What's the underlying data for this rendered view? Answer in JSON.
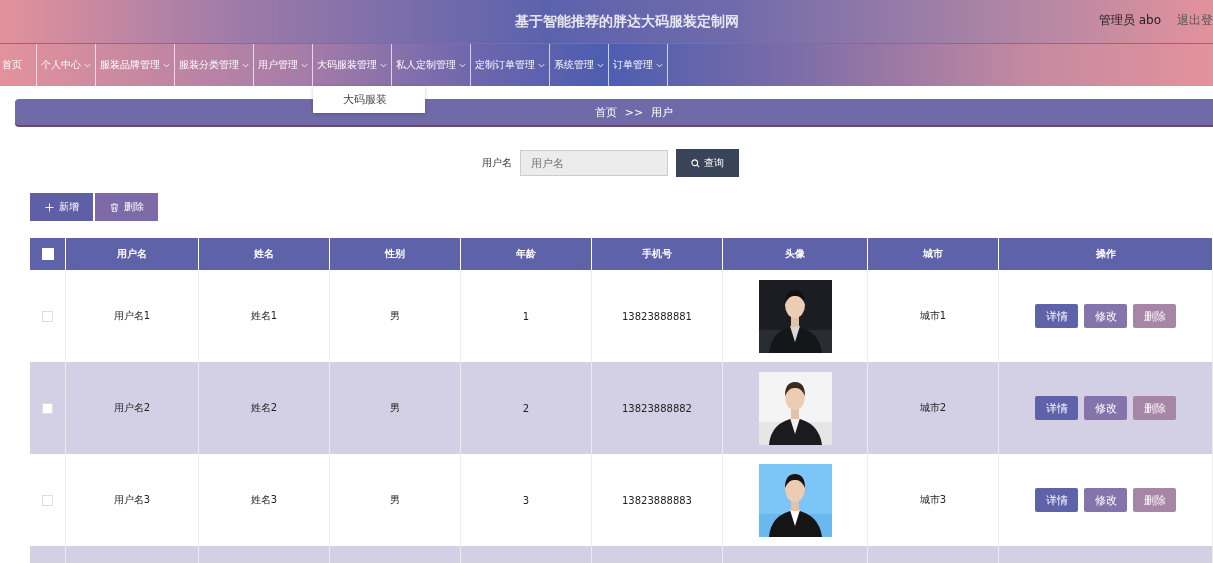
{
  "header": {
    "title": "基于智能推荐的胖达大码服装定制网",
    "user": "管理员 abo",
    "logout": "退出登"
  },
  "nav": [
    {
      "label": "首页",
      "caret": false,
      "expanded": false
    },
    {
      "label": "个人中心",
      "caret": true,
      "expanded": false
    },
    {
      "label": "服装品牌管理",
      "caret": true,
      "expanded": false
    },
    {
      "label": "服装分类管理",
      "caret": true,
      "expanded": false
    },
    {
      "label": "用户管理",
      "caret": true,
      "expanded": false
    },
    {
      "label": "大码服装管理",
      "caret": true,
      "expanded": true,
      "children": [
        "大码服装"
      ]
    },
    {
      "label": "私人定制管理",
      "caret": true,
      "expanded": false
    },
    {
      "label": "定制订单管理",
      "caret": true,
      "expanded": false
    },
    {
      "label": "系统管理",
      "caret": true,
      "expanded": false
    },
    {
      "label": "订单管理",
      "caret": true,
      "expanded": false
    }
  ],
  "breadcrumb": {
    "home": "首页",
    "separator": ">>",
    "current": "用户"
  },
  "search": {
    "label": "用户名",
    "placeholder": "用户名",
    "button": "查询"
  },
  "actions": [
    {
      "kind": "add",
      "label": "新增"
    },
    {
      "kind": "delete",
      "label": "删除"
    }
  ],
  "table": {
    "select_all": {
      "checked": false
    },
    "columns": [
      "用户名",
      "姓名",
      "性别",
      "年龄",
      "手机号",
      "头像",
      "城市",
      "操作"
    ],
    "rows": [
      {
        "checked": false,
        "cells": [
          "用户名1",
          "姓名1",
          "男",
          "1",
          "13823888881"
        ],
        "city": "城市1",
        "buttons": [
          "详情",
          "修改",
          "删除"
        ]
      },
      {
        "checked": false,
        "cells": [
          "用户名2",
          "姓名2",
          "男",
          "2",
          "13823888882"
        ],
        "city": "城市2",
        "buttons": [
          "详情",
          "修改",
          "删除"
        ]
      },
      {
        "checked": false,
        "cells": [
          "用户名3",
          "姓名3",
          "男",
          "3",
          "13823888883"
        ],
        "city": "城市3",
        "buttons": [
          "详情",
          "修改",
          "删除"
        ]
      }
    ]
  }
}
